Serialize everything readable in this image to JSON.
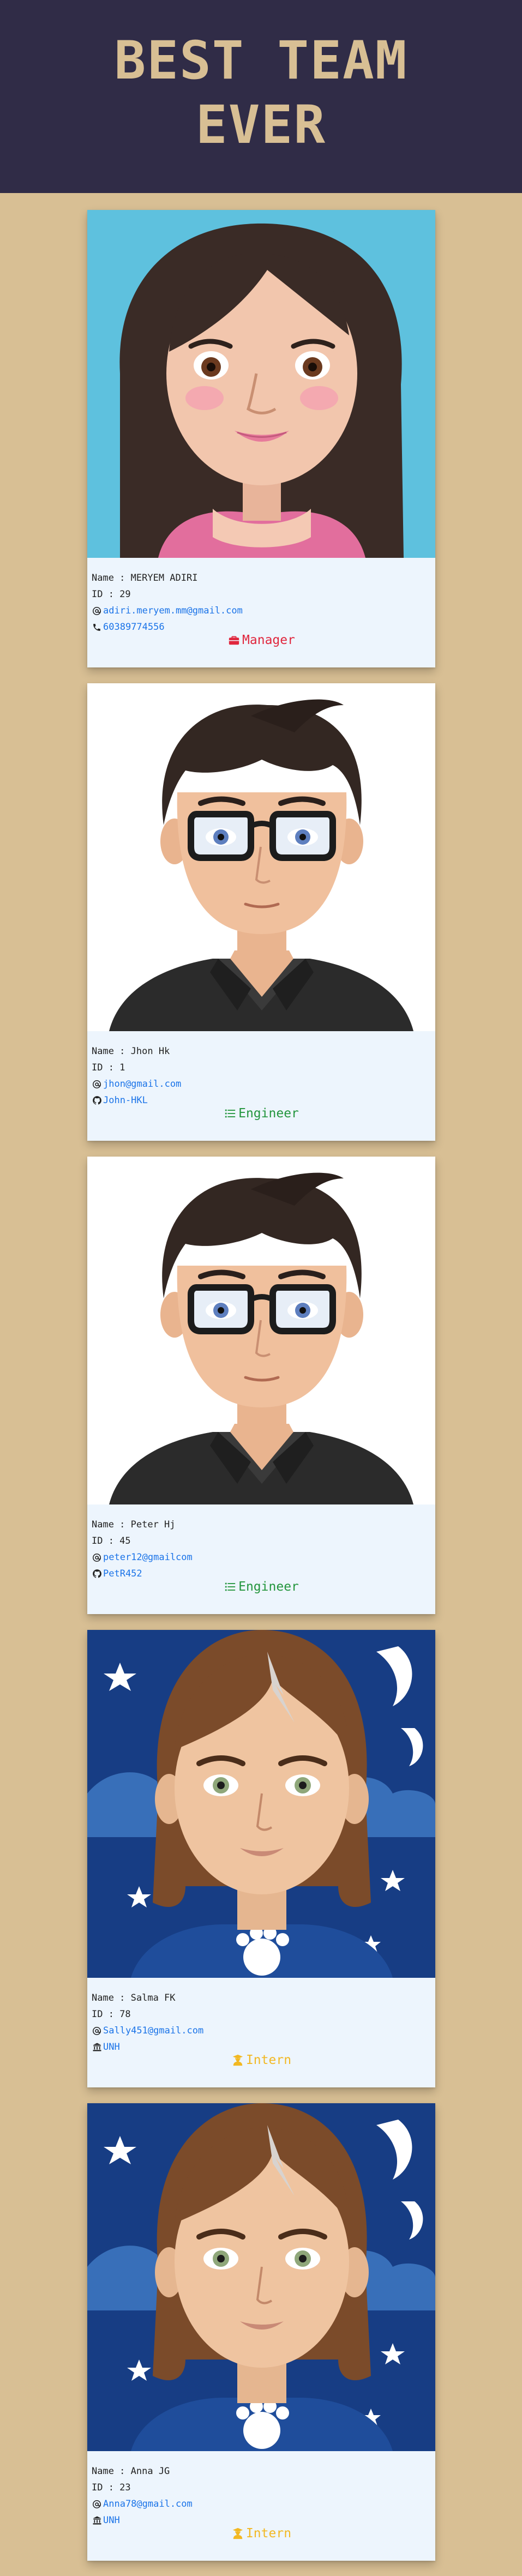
{
  "page_title": [
    "BEST TEAM",
    "EVER"
  ],
  "colors": {
    "header_bg": "#302c47",
    "page_bg": "#d8bf94",
    "card_bg": "#edf5fd",
    "link": "#1a73e8",
    "manager": "#e0263d",
    "engineer": "#23953d",
    "intern": "#f2b822"
  },
  "members": [
    {
      "name": "Name : MERYEM ADIRI",
      "id": "ID : 29",
      "email": "adiri.meryem.mm@gmail.com",
      "contact_icon": "phone-icon",
      "contact": "60389774556",
      "role_icon": "briefcase-icon",
      "role": "Manager",
      "avatar": "woman-avatar"
    },
    {
      "name": "Name : Jhon Hk",
      "id": "ID : 1",
      "email": "jhon@gmail.com",
      "contact_icon": "github-icon",
      "contact": "John-HKL",
      "role_icon": "list-icon",
      "role": "Engineer",
      "avatar": "man-glasses-avatar"
    },
    {
      "name": "Name : Peter Hj",
      "id": "ID : 45",
      "email": "peter12@gmailcom",
      "contact_icon": "github-icon",
      "contact": "PetR452",
      "role_icon": "list-icon",
      "role": "Engineer",
      "avatar": "man-glasses-avatar"
    },
    {
      "name": "Name : Salma FK",
      "id": "ID : 78",
      "email": "Sally451@gmail.com",
      "contact_icon": "school-icon",
      "contact": "UNH",
      "role_icon": "graduate-icon",
      "role": "Intern",
      "avatar": "girl-night-avatar"
    },
    {
      "name": "Name : Anna JG",
      "id": "ID : 23",
      "email": "Anna78@gmail.com",
      "contact_icon": "school-icon",
      "contact": "UNH",
      "role_icon": "graduate-icon",
      "role": "Intern",
      "avatar": "girl-night-avatar"
    }
  ]
}
